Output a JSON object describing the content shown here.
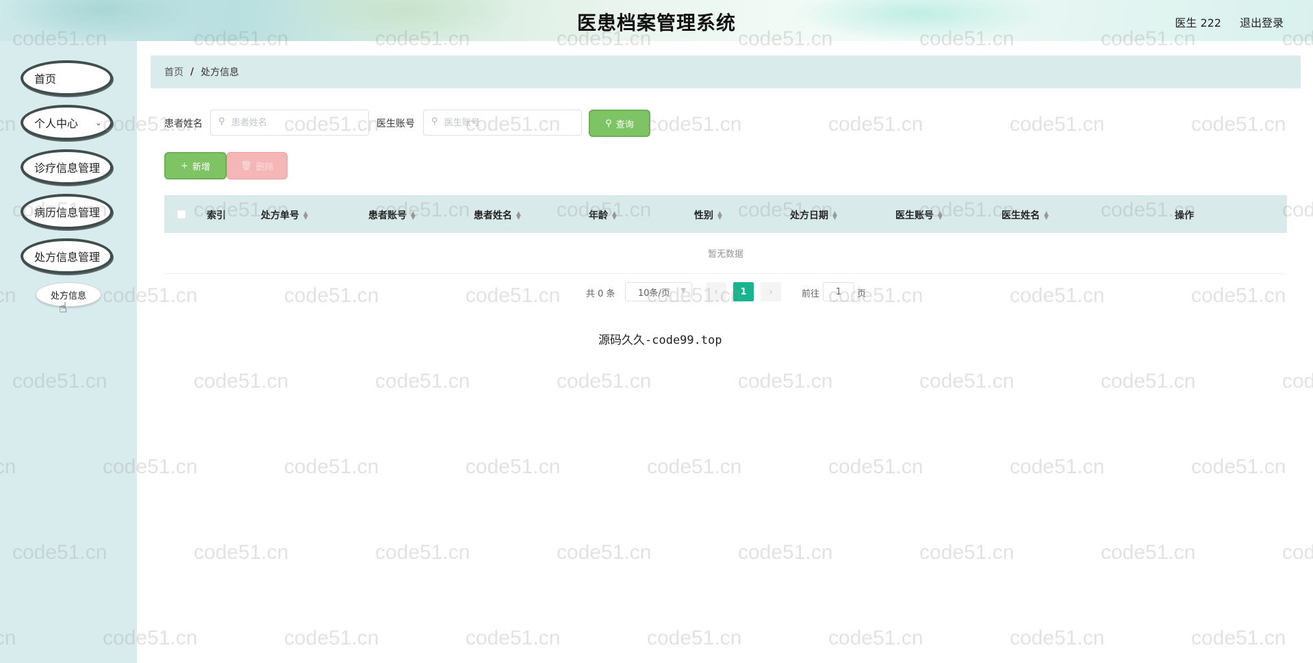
{
  "header": {
    "title": "医患档案管理系统",
    "user": "医生 222",
    "logout": "退出登录"
  },
  "sidebar": {
    "items": [
      {
        "label": "首页"
      },
      {
        "label": "个人中心"
      },
      {
        "label": "诊疗信息管理"
      },
      {
        "label": "病历信息管理"
      },
      {
        "label": "处方信息管理"
      }
    ],
    "sub_item": "处方信息"
  },
  "breadcrumb": {
    "home": "首页",
    "separator": "/",
    "current": "处方信息"
  },
  "search": {
    "patient_name_label": "患者姓名",
    "patient_name_placeholder": "患者姓名",
    "doctor_account_label": "医生账号",
    "doctor_account_placeholder": "医生账号",
    "query_button": "查询"
  },
  "actions": {
    "add": "新增",
    "delete": "删除"
  },
  "table": {
    "columns": [
      "索引",
      "处方单号",
      "患者账号",
      "患者姓名",
      "年龄",
      "性别",
      "处方日期",
      "医生账号",
      "医生姓名",
      "操作"
    ],
    "empty_text": "暂无数据"
  },
  "pagination": {
    "total": "共 0 条",
    "page_size": "10条/页",
    "current_page": "1",
    "goto_label": "前往",
    "goto_value": "1",
    "goto_unit": "页"
  },
  "footer": "源码久久-code99.top",
  "watermark": "code51.cn",
  "colors": {
    "accent": "#16b58f",
    "button_green": "#7ec464",
    "button_red": "#f4b6b6",
    "sidebar_bg": "#d9eced"
  }
}
